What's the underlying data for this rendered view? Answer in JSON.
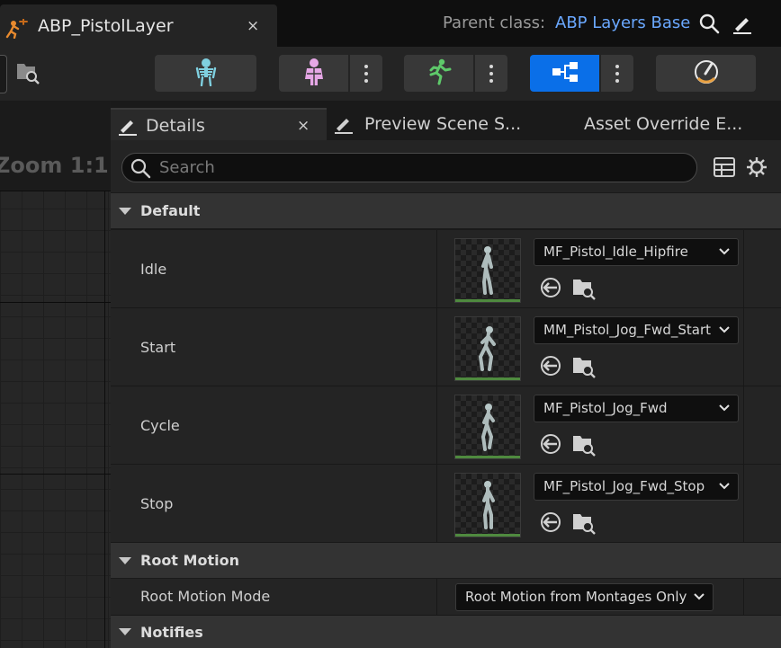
{
  "window": {
    "asset_tab_title": "ABP_PistolLayer",
    "asset_tab_close": "×",
    "parent_class_label": "Parent class:",
    "parent_class_value": "ABP Layers Base"
  },
  "toolbar": {
    "active_mode": "blueprint-graph",
    "accent_color": "#0a6fe8"
  },
  "graph": {
    "zoom_label": "Zoom 1:1"
  },
  "details": {
    "tabs": [
      {
        "label": "Details",
        "close": "×"
      },
      {
        "label": "Preview Scene S..."
      },
      {
        "label": "Asset Override E..."
      }
    ],
    "search_placeholder": "Search",
    "categories": {
      "default": "Default",
      "root_motion": "Root Motion",
      "notifies": "Notifies"
    },
    "properties": [
      {
        "name": "Idle",
        "value": "MF_Pistol_Idle_Hipfire"
      },
      {
        "name": "Start",
        "value": "MM_Pistol_Jog_Fwd_Start"
      },
      {
        "name": "Cycle",
        "value": "MF_Pistol_Jog_Fwd"
      },
      {
        "name": "Stop",
        "value": "MF_Pistol_Jog_Fwd_Stop"
      }
    ],
    "root_motion_mode": {
      "name": "Root Motion Mode",
      "value": "Root Motion from Montages Only"
    }
  }
}
